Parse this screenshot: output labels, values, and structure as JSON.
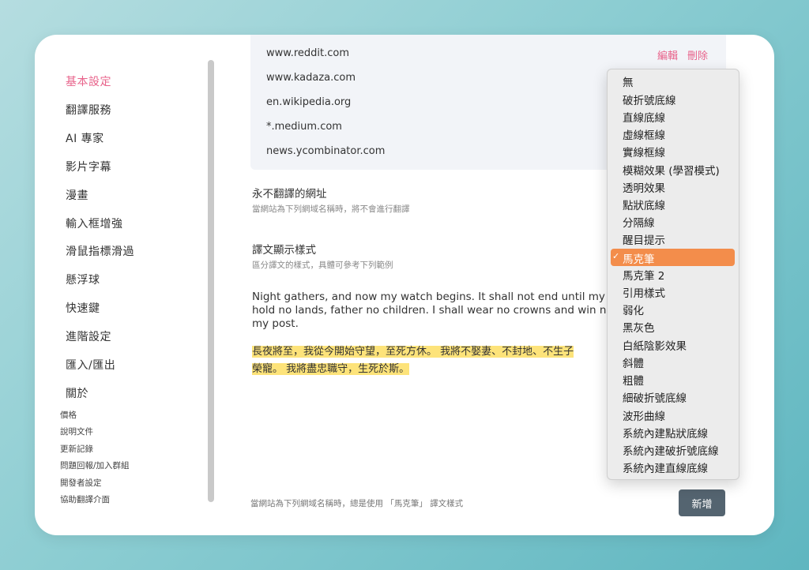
{
  "sidebar": {
    "items": [
      {
        "label": "基本設定",
        "active": true
      },
      {
        "label": "翻譯服務"
      },
      {
        "label": "AI 專家"
      },
      {
        "label": "影片字幕"
      },
      {
        "label": "漫畫"
      },
      {
        "label": "輸入框增強"
      },
      {
        "label": "滑鼠指標滑過"
      },
      {
        "label": "懸浮球"
      },
      {
        "label": "快速鍵"
      },
      {
        "label": "進階設定"
      },
      {
        "label": "匯入/匯出"
      },
      {
        "label": "關於"
      }
    ],
    "sub_items": [
      "價格",
      "說明文件",
      "更新記錄",
      "問題回報/加入群組",
      "開發者設定",
      "協助翻譯介面"
    ]
  },
  "domains": [
    "www.reddit.com",
    "www.kadaza.com",
    "en.wikipedia.org",
    "*.medium.com",
    "news.ycombinator.com"
  ],
  "domain_actions": {
    "edit": "編輯",
    "delete": "刪除"
  },
  "never_translate": {
    "title": "永不翻譯的網址",
    "desc": "當網站為下列網域名稱時，將不會進行翻譯"
  },
  "display_style": {
    "title": "譯文顯示樣式",
    "desc": "區分譯文的樣式，具體可參考下列範例"
  },
  "sample": {
    "en_lines": [
      "Night gathers, and now my watch begins. It shall not end until my death.",
      "hold no lands, father no children. I shall wear no crowns and win no glory.",
      "my post."
    ],
    "zh_line1": "長夜將至，我從今開始守望，至死方休。 我將不娶妻、不封地、不生子",
    "zh_line2": "榮寵。 我將盡忠職守，生死於斯。"
  },
  "footer_note": "當網站為下列網域名稱時，總是使用 「馬克筆」 譯文樣式",
  "add_button": "新增",
  "dropdown": {
    "options": [
      "無",
      "破折號底線",
      "直線底線",
      "虛線框線",
      "實線框線",
      "模糊效果 (學習模式)",
      "透明效果",
      "點狀底線",
      "分隔線",
      "醒目提示",
      "馬克筆",
      "馬克筆 2",
      "引用樣式",
      "弱化",
      "黑灰色",
      "白紙陰影效果",
      "斜體",
      "粗體",
      "細破折號底線",
      "波形曲線",
      "系統內建點狀底線",
      "系統內建破折號底線",
      "系統內建直線底線"
    ],
    "selected": "馬克筆",
    "check_glyph": "✓"
  },
  "colors": {
    "accent": "#e8638b",
    "selected_bg": "#f38d4b",
    "highlight": "#fde37a",
    "button": "#546470"
  }
}
